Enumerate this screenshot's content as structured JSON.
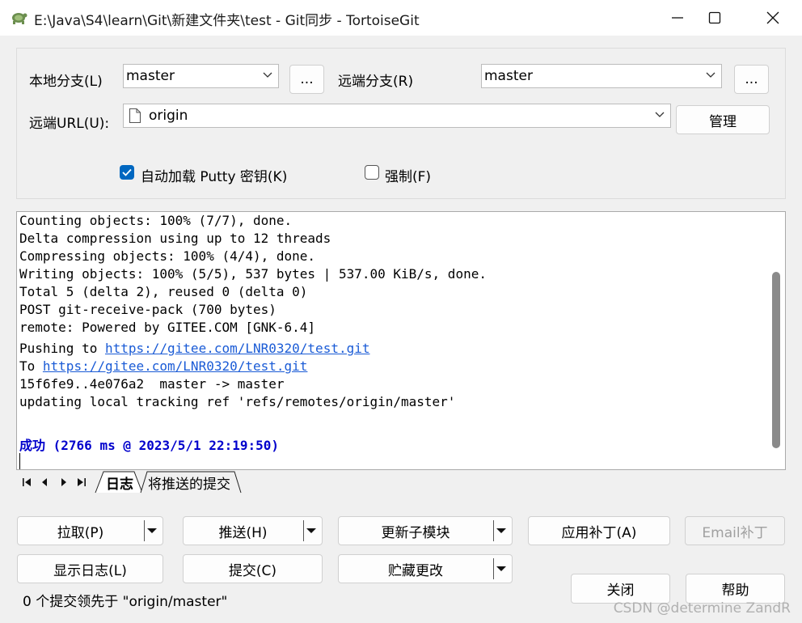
{
  "window": {
    "title": "E:\\Java\\S4\\learn\\Git\\新建文件夹\\test - Git同步 - TortoiseGit",
    "icon": "tortoise-icon"
  },
  "top": {
    "local_branch_label": "本地分支(L)",
    "local_branch_value": "master",
    "browse_local_label": "...",
    "remote_branch_label": "远端分支(R)",
    "remote_branch_value": "master",
    "browse_remote_label": "...",
    "remote_url_label": "远端URL(U):",
    "remote_url_value": "origin",
    "manage_label": "管理",
    "autoload_putty_label": "自动加载 Putty 密钥(K)",
    "autoload_putty_checked": true,
    "force_label": "强制(F)",
    "force_checked": false
  },
  "log": {
    "lines": [
      "Counting objects: 100% (7/7), done.",
      "Delta compression using up to 12 threads",
      "Compressing objects: 100% (4/4), done.",
      "Writing objects: 100% (5/5), 537 bytes | 537.00 KiB/s, done.",
      "Total 5 (delta 2), reused 0 (delta 0)",
      "POST git-receive-pack (700 bytes)",
      "remote: Powered by GITEE.COM [GNK-6.4]"
    ],
    "pushing_prefix": "Pushing to ",
    "pushing_url": "https://gitee.com/LNR0320/test.git",
    "to_prefix": "To ",
    "to_url": "https://gitee.com/LNR0320/test.git",
    "after_lines": [
      "15f6fe9..4e076a2  master -> master",
      "updating local tracking ref 'refs/remotes/origin/master'"
    ],
    "success_word": "成功",
    "success_detail": " (2766 ms @ 2023/5/1 22:19:50)"
  },
  "tabs": {
    "log_tab": "日志",
    "to_push_tab": "将推送的提交"
  },
  "buttons": {
    "pull": "拉取(P)",
    "push": "推送(H)",
    "update_submodules": "更新子模块",
    "apply_patch": "应用补丁(A)",
    "email_patch": "Email补丁",
    "show_log": "显示日志(L)",
    "commit": "提交(C)",
    "stash": "贮藏更改",
    "close": "关闭",
    "help": "帮助"
  },
  "status": {
    "text": "0 个提交领先于 \"origin/master\""
  },
  "watermark": {
    "text": "CSDN @determine  ZandR"
  },
  "colors": {
    "accent": "#0067c0",
    "link": "#1a5bd6",
    "success": "#0000cc"
  }
}
